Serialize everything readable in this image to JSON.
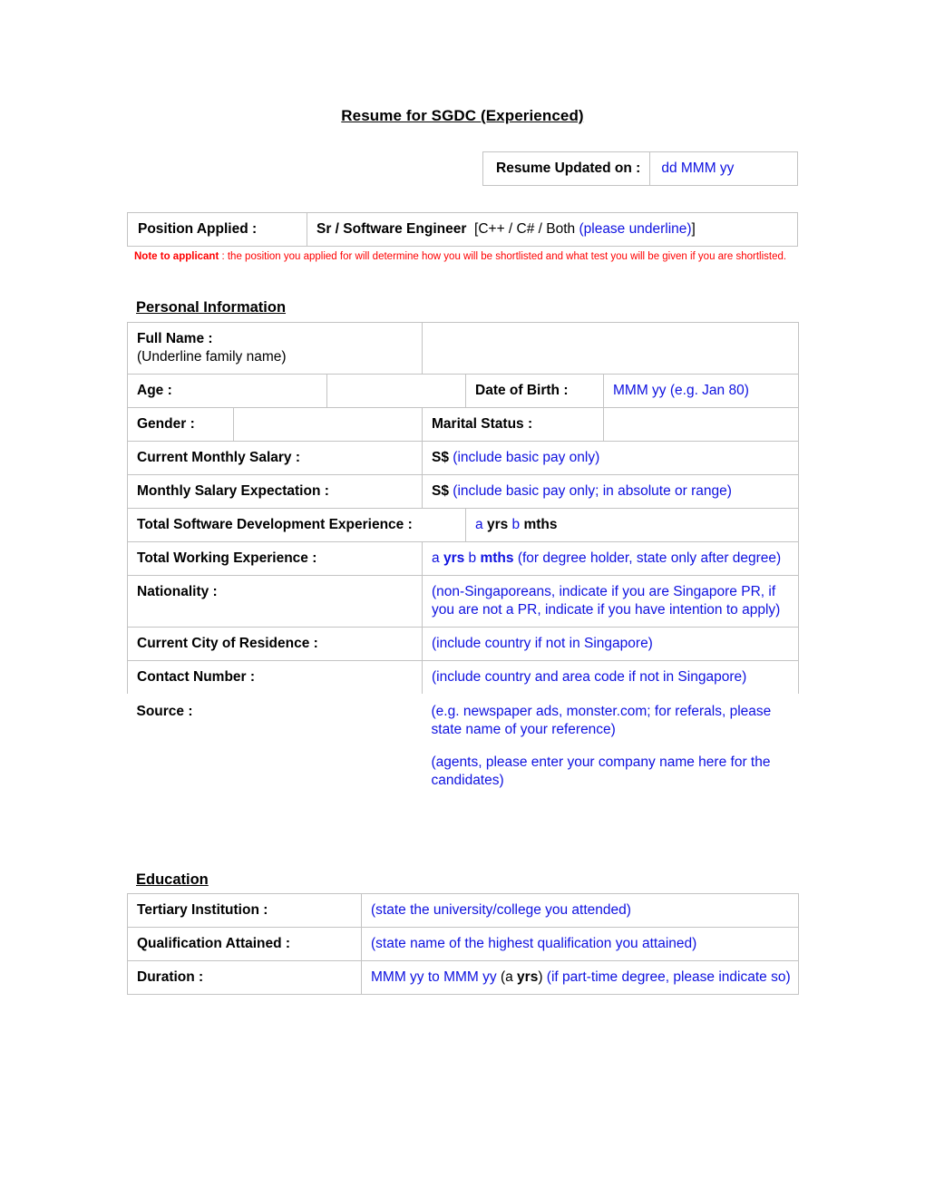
{
  "document": {
    "title": "Resume for SGDC (Experienced)"
  },
  "updated": {
    "label": "Resume Updated on :",
    "value": "dd MMM yy"
  },
  "position": {
    "label": "Position Applied :",
    "role": "Sr / Software Engineer",
    "bracket_open": "[C++ / C# / Both ",
    "bracket_hint": "(please underline)",
    "bracket_close": "]",
    "note_bold": "Note to applicant",
    "note_rest": " : the position you applied for will determine how you will be shortlisted and what test you will be given if you are shortlisted."
  },
  "sections": {
    "personal_heading": "Personal Information",
    "education_heading": "Education"
  },
  "personal": {
    "full_name_label": "Full Name :",
    "full_name_sub": "(Underline family name)",
    "full_name_value": "",
    "age_label": "Age :",
    "age_value": "",
    "dob_label": "Date of Birth :",
    "dob_value": "MMM yy (e.g. Jan 80)",
    "gender_label": "Gender :",
    "gender_value": "",
    "marital_label": "Marital Status :",
    "marital_value": "",
    "current_salary_label": "Current Monthly Salary :",
    "current_salary_currency": "S$",
    "current_salary_hint": "(include basic pay only)",
    "salary_expectation_label": "Monthly Salary Expectation :",
    "salary_expectation_currency": "S$",
    "salary_expectation_hint": "(include basic pay only; in absolute or range)",
    "dev_experience_label": "Total Software Development Experience :",
    "dev_experience_a": "a",
    "dev_experience_yrs": "yrs",
    "dev_experience_b": "b",
    "dev_experience_mths": "mths",
    "working_experience_label": "Total Working Experience :",
    "working_experience_a": "a",
    "working_experience_yrs": "yrs",
    "working_experience_b": "b",
    "working_experience_mths": "mths",
    "working_experience_hint": "(for degree holder, state only after degree)",
    "nationality_label": "Nationality :",
    "nationality_hint": "(non-Singaporeans, indicate if you are Singapore PR, if you are not a PR, indicate if you have intention to apply)",
    "city_label": "Current City of Residence :",
    "city_hint": "(include country if not in Singapore)",
    "contact_label": "Contact Number :",
    "contact_hint": "(include country and area code if not in Singapore)",
    "source_label": "Source :",
    "source_hint_1": "(e.g. newspaper ads, monster.com; for referals, please state name of your reference)",
    "source_hint_2": "(agents, please enter your company name here for the candidates)"
  },
  "education": {
    "institution_label": "Tertiary Institution :",
    "institution_hint": "(state the university/college you attended)",
    "qualification_label": "Qualification Attained :",
    "qualification_hint": "(state name of the highest qualification you attained)",
    "duration_label": "Duration :",
    "duration_range": "MMM yy to MMM yy ",
    "duration_years_a": "a",
    "duration_years_unit": "yrs",
    "duration_hint": " (if part-time degree, please indicate so)"
  },
  "colors": {
    "field_hint": "#0f12e0",
    "note": "#fe0000",
    "border": "#c3c3c3",
    "text": "#000000"
  }
}
